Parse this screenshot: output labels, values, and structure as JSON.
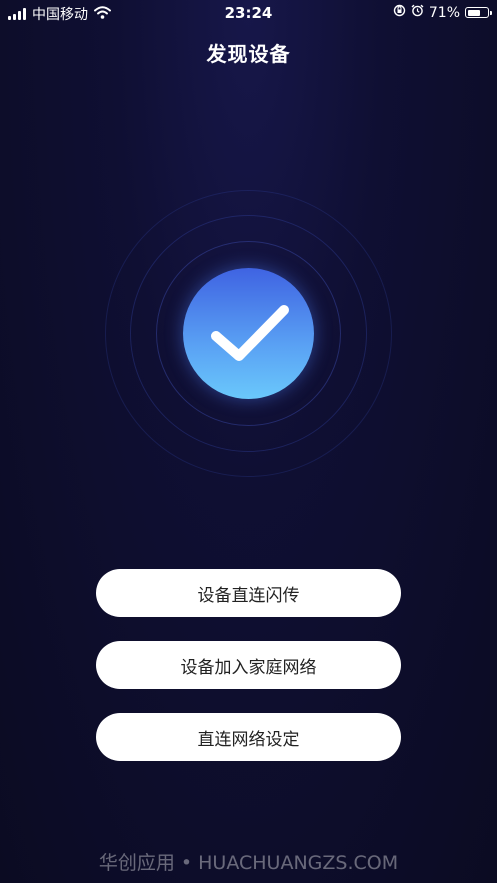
{
  "status_bar": {
    "carrier": "中国移动",
    "time": "23:24",
    "battery_percent": "71%",
    "battery_level": 0.71,
    "icons": [
      "signal-icon",
      "wifi-icon",
      "orientation-lock-icon",
      "alarm-icon",
      "battery-icon"
    ]
  },
  "header": {
    "title": "发现设备"
  },
  "status_graphic": {
    "icon": "checkmark-icon",
    "colors": {
      "top": "#3f63e2",
      "bottom": "#6ac8fb"
    }
  },
  "actions": [
    {
      "label": "设备直连闪传"
    },
    {
      "label": "设备加入家庭网络"
    },
    {
      "label": "直连网络设定"
    }
  ],
  "watermark": "华创应用 • HUACHUANGZS.COM",
  "colors": {
    "background": "#0f0f33",
    "button_bg": "#ffffff",
    "button_text": "#222222"
  }
}
